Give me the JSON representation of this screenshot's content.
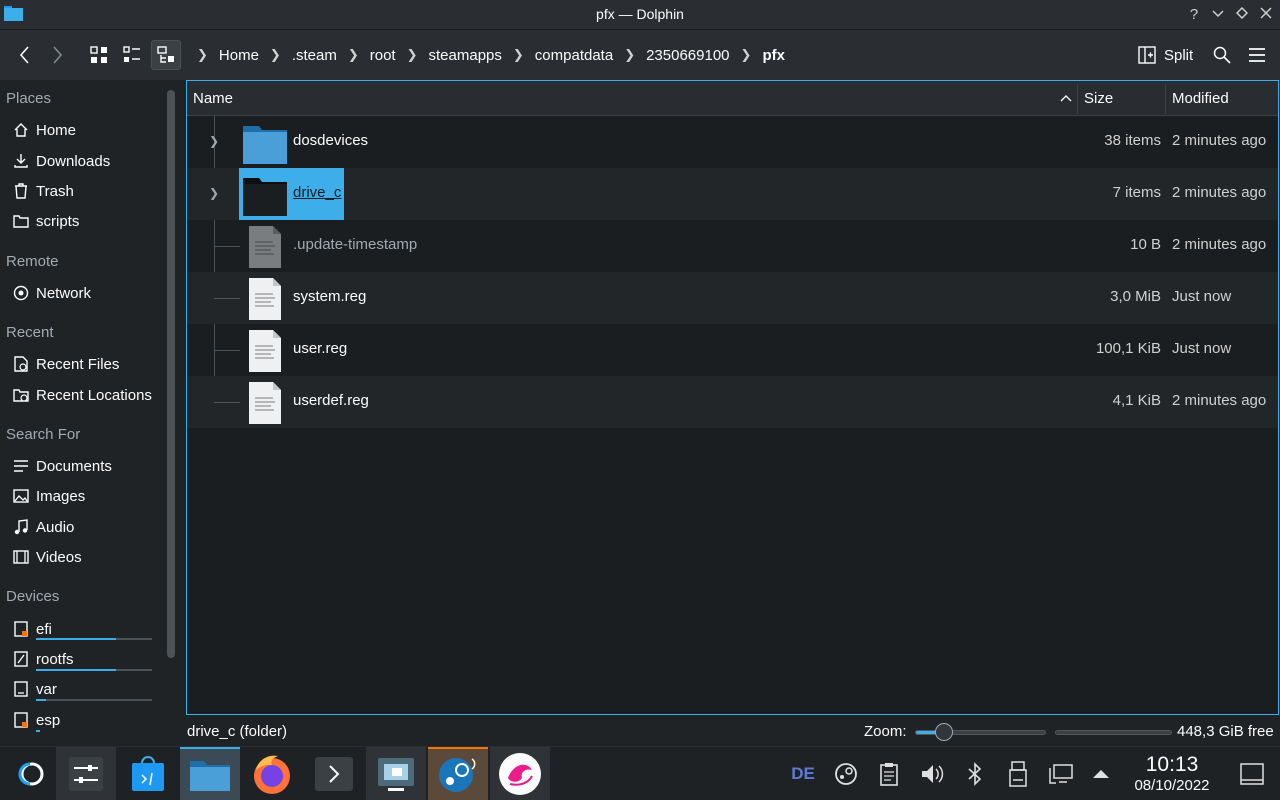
{
  "window": {
    "title": "pfx — Dolphin"
  },
  "toolbar": {
    "breadcrumbs": [
      "Home",
      ".steam",
      "root",
      "steamapps",
      "compatdata",
      "2350669100",
      "pfx"
    ],
    "split_label": "Split"
  },
  "sidebar": {
    "places_label": "Places",
    "places": [
      "Home",
      "Downloads",
      "Trash",
      "scripts"
    ],
    "remote_label": "Remote",
    "remote": [
      "Network"
    ],
    "recent_label": "Recent",
    "recent": [
      "Recent Files",
      "Recent Locations"
    ],
    "search_label": "Search For",
    "search": [
      "Documents",
      "Images",
      "Audio",
      "Videos"
    ],
    "devices_label": "Devices",
    "devices": [
      "efi",
      "rootfs",
      "var",
      "esp"
    ]
  },
  "columns": {
    "name": "Name",
    "size": "Size",
    "modified": "Modified"
  },
  "files": [
    {
      "name": "dosdevices",
      "size": "38 items",
      "modified": "2 minutes ago",
      "type": "folder"
    },
    {
      "name": "drive_c",
      "size": "7 items",
      "modified": "2 minutes ago",
      "type": "folder-selected"
    },
    {
      "name": ".update-timestamp",
      "size": "10 B",
      "modified": "2 minutes ago",
      "type": "hidden-file"
    },
    {
      "name": "system.reg",
      "size": "3,0 MiB",
      "modified": "Just now",
      "type": "text-file"
    },
    {
      "name": "user.reg",
      "size": "100,1 KiB",
      "modified": "Just now",
      "type": "text-file"
    },
    {
      "name": "userdef.reg",
      "size": "4,1 KiB",
      "modified": "2 minutes ago",
      "type": "text-file"
    }
  ],
  "status": {
    "selection": "drive_c (folder)",
    "zoom_label": "Zoom:",
    "zoom_level": 0.22,
    "free_space": "448,3 GiB free",
    "free_fraction": 0.99
  },
  "taskbar": {
    "keyboard_layout": "DE",
    "time": "10:13",
    "date": "08/10/2022"
  },
  "colors": {
    "accent": "#3daee9",
    "background": "#202326",
    "view": "#1b1e20"
  }
}
